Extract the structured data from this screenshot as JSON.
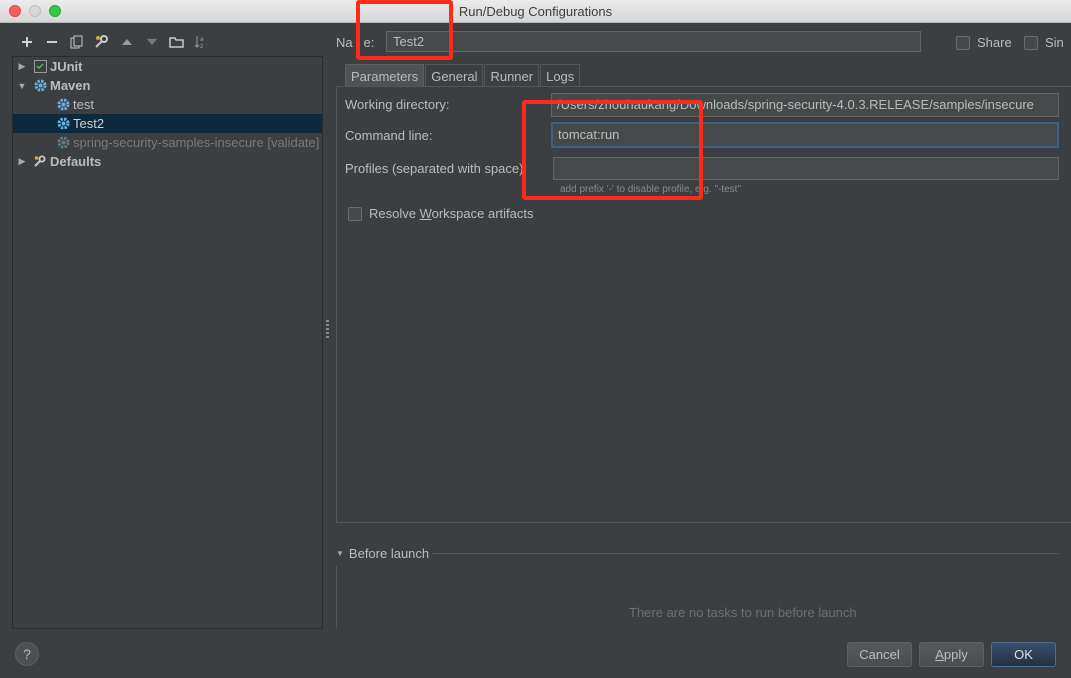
{
  "window": {
    "title": "Run/Debug Configurations"
  },
  "toolbar": {
    "icons": [
      "plus-icon",
      "minus-icon",
      "copy-icon",
      "wrench-icon",
      "arrow-up-icon",
      "arrow-down-icon",
      "folder-icon",
      "sort-az-icon"
    ]
  },
  "tree": {
    "items": [
      {
        "label": "JUnit"
      },
      {
        "label": "Maven"
      },
      {
        "label": "test"
      },
      {
        "label": "Test2"
      },
      {
        "label": "spring-security-samples-insecure [validate]"
      },
      {
        "label": "Defaults"
      }
    ]
  },
  "form": {
    "name_label_pre": "Na",
    "name_label_post": "e:",
    "name_value": "Test2",
    "share_label": "Share",
    "single_label": "Sin"
  },
  "tabs": [
    {
      "label": "Parameters"
    },
    {
      "label": "General"
    },
    {
      "label": "Runner"
    },
    {
      "label": "Logs"
    }
  ],
  "parameters": {
    "working_dir_label": "Working directory:",
    "working_dir_value": "/Users/zhouhaukang/Downloads/spring-security-4.0.3.RELEASE/samples/insecure",
    "command_line_label": "Command line:",
    "command_line_value": "tomcat:run",
    "profiles_label": "Profiles (separated with space):",
    "profiles_value": "",
    "profiles_hint": "add prefix '-' to disable profile, e.g. \"-test\"",
    "resolve_label_pre": "Resolve ",
    "resolve_label_u": "W",
    "resolve_label_post": "orkspace artifacts"
  },
  "before_launch": {
    "title": "Before launch",
    "empty_text": "There are no tasks to run before launch"
  },
  "buttons": {
    "help": "?",
    "cancel": "Cancel",
    "apply_u": "A",
    "apply_rest": "pply",
    "ok": "OK"
  },
  "colors": {
    "highlight_box": "#ff2a1a",
    "selection": "#0d293e",
    "background": "#3c3f41"
  }
}
